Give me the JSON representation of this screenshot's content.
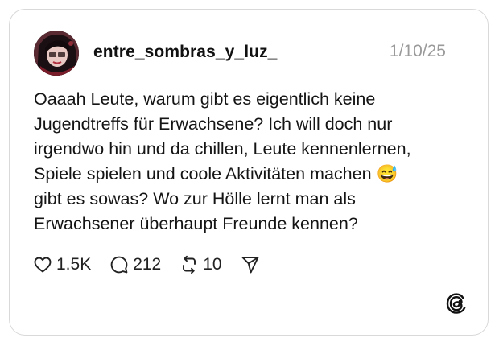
{
  "post": {
    "username": "entre_sombras_y_luz_",
    "date": "1/10/25",
    "text_lines": [
      "Oaaah Leute, warum gibt es eigentlich keine",
      "Jugendtreffs für Erwachsene? Ich will doch nur",
      "irgendwo hin und da chillen, Leute kennenlernen,",
      "Spiele spielen und coole Aktivitäten machen 😅",
      "gibt es sowas? Wo zur Hölle lernt man als",
      "Erwachsener überhaupt Freunde kennen?"
    ],
    "actions": {
      "likes": "1.5K",
      "replies": "212",
      "reposts": "10"
    }
  },
  "icons": {
    "like": "heart-icon",
    "reply": "comment-bubble-icon",
    "repost": "repost-icon",
    "share": "send-icon",
    "brand": "threads-logo-icon"
  },
  "colors": {
    "border": "#d9d9d9",
    "text": "#141414",
    "muted": "#9a9a9a"
  }
}
